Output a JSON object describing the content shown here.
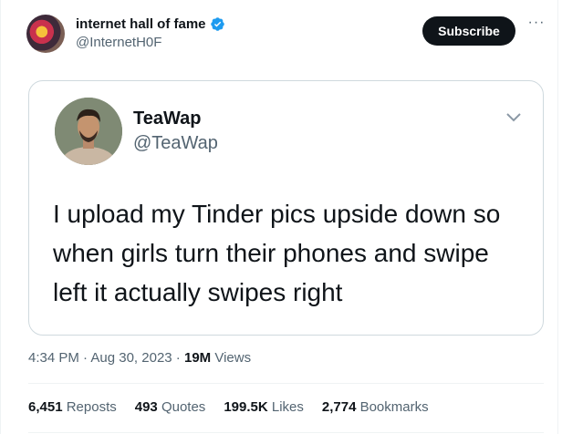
{
  "author": {
    "name": "internet hall of fame",
    "handle": "@InternetH0F",
    "verified_color": "#1d9bf0"
  },
  "actions": {
    "subscribe_label": "Subscribe",
    "more_icon": "more-horizontal-icon"
  },
  "quoted_tweet": {
    "name": "TeaWap",
    "handle": "@TeaWap",
    "text": "I upload my Tinder pics upside down so when girls turn their phones and swipe left it actually swipes right"
  },
  "meta": {
    "time": "4:34 PM",
    "separator1": " · ",
    "date": "Aug 30, 2023",
    "separator2": " · ",
    "views_count": "19M",
    "views_label": " Views"
  },
  "stats": {
    "reposts_count": "6,451",
    "reposts_label": " Reposts",
    "quotes_count": "493",
    "quotes_label": " Quotes",
    "likes_count": "199.5K",
    "likes_label": " Likes",
    "bookmarks_count": "2,774",
    "bookmarks_label": " Bookmarks"
  }
}
